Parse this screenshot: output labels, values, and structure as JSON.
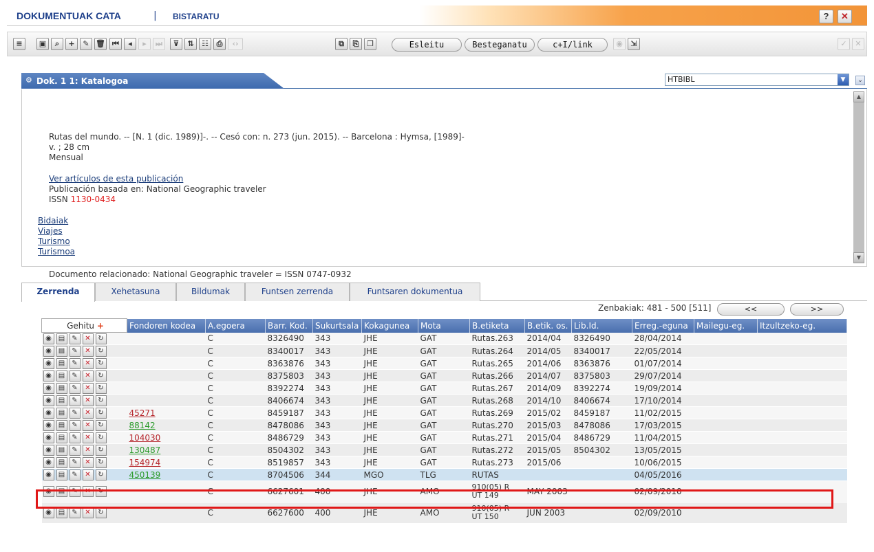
{
  "titlebar": {
    "app_title": "DOKUMENTUAK CATA",
    "separator": "|",
    "subtitle": "BISTARATU",
    "help": "?",
    "close": "✕"
  },
  "toolbar": {
    "icons": [
      "menu-icon",
      "view-icon",
      "search-icon",
      "add-icon",
      "edit-icon",
      "delete-icon",
      "first-icon",
      "prev-icon",
      "next-icon",
      "last-icon",
      "filter-icon",
      "sort-icon",
      "columns-icon",
      "print-icon",
      "nav-icon",
      "copy-icon",
      "paste-icon",
      "duplicate-icon",
      "camera-icon",
      "export-icon",
      "confirm-icon",
      "cancel-icon"
    ],
    "esleitu": "Esleitu",
    "besteganatu": "Besteganatu",
    "link": "c+I/link"
  },
  "doc": {
    "title": "Dok. 1 1: Katalogoa",
    "format": "HTBIBL",
    "line1": "Rutas del mundo. -- [N. 1 (dic. 1989)]-. -- Cesó con: n. 273 (jun. 2015). -- Barcelona : Hymsa, [1989]-",
    "line2": "v. ; 28 cm",
    "line3": "Mensual",
    "link_articles": "Ver artículos de esta publicación",
    "based_on": "Publicación basada en: National Geographic traveler",
    "issn_label": "ISSN",
    "issn_value": "1130-0434",
    "subjects": [
      "Bidaiak",
      "Viajes",
      "Turismo",
      "Turismoa"
    ],
    "related": "Documento relacionado: National Geographic traveler = ISSN 0747-0932"
  },
  "tabs": [
    "Zerrenda",
    "Xehetasuna",
    "Bildumak",
    "Funtsen zerrenda",
    "Funtsaren dokumentua"
  ],
  "pagination": {
    "range": "Zenbakiak: 481 - 500 [511]",
    "prev": "<<",
    "next": ">>"
  },
  "table": {
    "add_label": "Gehitu",
    "add_symbol": "+",
    "headers": [
      "Fondoren kodea",
      "A.egoera",
      "Barr. Kod.",
      "Sukurtsala",
      "Kokagunea",
      "Mota",
      "B.etiketa",
      "B.etik. os.",
      "Lib.Id.",
      "Erreg.-eguna",
      "Mailegu-eg.",
      "Itzultzeko-eg."
    ],
    "rows": [
      [
        "",
        "C",
        "8326490",
        "343",
        "JHE",
        "GAT",
        "Rutas.263",
        "2014/04",
        "8326490",
        "28/04/2014",
        "",
        ""
      ],
      [
        "",
        "C",
        "8340017",
        "343",
        "JHE",
        "GAT",
        "Rutas.264",
        "2014/05",
        "8340017",
        "22/05/2014",
        "",
        ""
      ],
      [
        "",
        "C",
        "8363876",
        "343",
        "JHE",
        "GAT",
        "Rutas.265",
        "2014/06",
        "8363876",
        "01/07/2014",
        "",
        ""
      ],
      [
        "",
        "C",
        "8375803",
        "343",
        "JHE",
        "GAT",
        "Rutas.266",
        "2014/07",
        "8375803",
        "29/07/2014",
        "",
        ""
      ],
      [
        "",
        "C",
        "8392274",
        "343",
        "JHE",
        "GAT",
        "Rutas.267",
        "2014/09",
        "8392274",
        "19/09/2014",
        "",
        ""
      ],
      [
        "",
        "C",
        "8406674",
        "343",
        "JHE",
        "GAT",
        "Rutas.268",
        "2014/10",
        "8406674",
        "17/10/2014",
        "",
        ""
      ],
      [
        "45271",
        "C",
        "8459187",
        "343",
        "JHE",
        "GAT",
        "Rutas.269",
        "2015/02",
        "8459187",
        "11/02/2015",
        "",
        ""
      ],
      [
        "88142",
        "C",
        "8478086",
        "343",
        "JHE",
        "GAT",
        "Rutas.270",
        "2015/03",
        "8478086",
        "17/03/2015",
        "",
        ""
      ],
      [
        "104030",
        "C",
        "8486729",
        "343",
        "JHE",
        "GAT",
        "Rutas.271",
        "2015/04",
        "8486729",
        "11/04/2015",
        "",
        ""
      ],
      [
        "130487",
        "C",
        "8504302",
        "343",
        "JHE",
        "GAT",
        "Rutas.272",
        "2015/05",
        "8504302",
        "13/05/2015",
        "",
        ""
      ],
      [
        "154974",
        "C",
        "8519857",
        "343",
        "JHE",
        "GAT",
        "Rutas.273",
        "2015/06",
        "",
        "10/06/2015",
        "",
        ""
      ],
      [
        "450139",
        "C",
        "8704506",
        "344",
        "MGO",
        "TLG",
        "RUTAS",
        "",
        "",
        "04/05/2016",
        "",
        ""
      ],
      [
        "",
        "C",
        "6627601",
        "400",
        "JHE",
        "AMO",
        "910(05) R UT 149",
        "MAY 2003",
        "",
        "02/09/2010",
        "",
        ""
      ],
      [
        "",
        "C",
        "6627600",
        "400",
        "JHE",
        "AMO",
        "910(05) R UT 150",
        "JUN 2003",
        "",
        "02/09/2010",
        "",
        ""
      ]
    ],
    "fondo_colors": [
      "",
      "",
      "",
      "",
      "",
      "",
      "#b5252a",
      "#2a9a2a",
      "#b5252a",
      "#2a9a2a",
      "#b5252a",
      "#2a9a2a",
      "",
      ""
    ],
    "selected_row": 11
  },
  "colors": {
    "accent_blue": "#1d3f8a",
    "header_blue": "#4a6fae",
    "highlight_red": "#e01818",
    "selected_row": "#cfe2f1"
  }
}
